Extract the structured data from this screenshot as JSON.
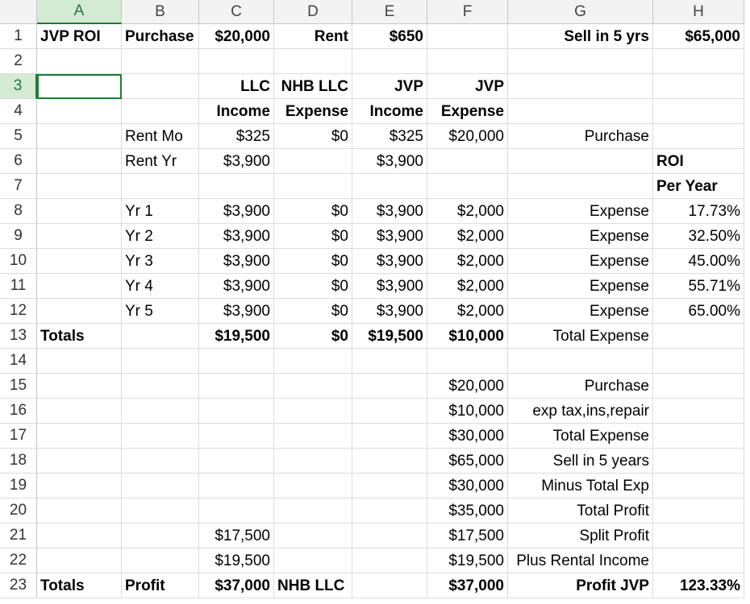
{
  "sheet": {
    "columns": [
      "A",
      "B",
      "C",
      "D",
      "E",
      "F",
      "G",
      "H"
    ],
    "selected_cell": "A3",
    "rows": [
      {
        "n": "1",
        "cells": {
          "A": "JVP ROI",
          "B": "Purchase",
          "C": "$20,000",
          "D": "Rent",
          "E": "$650",
          "G": "Sell in 5 yrs",
          "H": "$65,000"
        }
      },
      {
        "n": "2",
        "cells": {}
      },
      {
        "n": "3",
        "cells": {
          "C": "LLC",
          "D": "NHB LLC",
          "E": "JVP",
          "F": "JVP"
        }
      },
      {
        "n": "4",
        "cells": {
          "C": "Income",
          "D": "Expense",
          "E": "Income",
          "F": "Expense"
        }
      },
      {
        "n": "5",
        "cells": {
          "B": "Rent Mo",
          "C": "$325",
          "D": "$0",
          "E": "$325",
          "F": "$20,000",
          "G": "Purchase"
        }
      },
      {
        "n": "6",
        "cells": {
          "B": "Rent Yr",
          "C": "$3,900",
          "E": "$3,900",
          "H": "ROI"
        }
      },
      {
        "n": "7",
        "cells": {
          "H": "Per Year"
        }
      },
      {
        "n": "8",
        "cells": {
          "B": "Yr 1",
          "C": "$3,900",
          "D": "$0",
          "E": "$3,900",
          "F": "$2,000",
          "G": "Expense",
          "H": "17.73%"
        }
      },
      {
        "n": "9",
        "cells": {
          "B": "Yr 2",
          "C": "$3,900",
          "D": "$0",
          "E": "$3,900",
          "F": "$2,000",
          "G": "Expense",
          "H": "32.50%"
        }
      },
      {
        "n": "10",
        "cells": {
          "B": "Yr 3",
          "C": "$3,900",
          "D": "$0",
          "E": "$3,900",
          "F": "$2,000",
          "G": "Expense",
          "H": "45.00%"
        }
      },
      {
        "n": "11",
        "cells": {
          "B": "Yr 4",
          "C": "$3,900",
          "D": "$0",
          "E": "$3,900",
          "F": "$2,000",
          "G": "Expense",
          "H": "55.71%"
        }
      },
      {
        "n": "12",
        "cells": {
          "B": "Yr 5",
          "C": "$3,900",
          "D": "$0",
          "E": "$3,900",
          "F": "$2,000",
          "G": "Expense",
          "H": "65.00%"
        }
      },
      {
        "n": "13",
        "cells": {
          "A": "Totals",
          "C": "$19,500",
          "D": "$0",
          "E": "$19,500",
          "F": "$10,000",
          "G": "Total Expense"
        }
      },
      {
        "n": "14",
        "cells": {}
      },
      {
        "n": "15",
        "cells": {
          "F": "$20,000",
          "G": "Purchase"
        }
      },
      {
        "n": "16",
        "cells": {
          "F": "$10,000",
          "G": "exp tax,ins,repair"
        }
      },
      {
        "n": "17",
        "cells": {
          "F": "$30,000",
          "G": "Total Expense"
        }
      },
      {
        "n": "18",
        "cells": {
          "F": "$65,000",
          "G": "Sell in 5 years"
        }
      },
      {
        "n": "19",
        "cells": {
          "F": "$30,000",
          "G": "Minus Total Exp"
        }
      },
      {
        "n": "20",
        "cells": {
          "F": "$35,000",
          "G": "Total Profit"
        }
      },
      {
        "n": "21",
        "cells": {
          "C": "$17,500",
          "F": "$17,500",
          "G": "Split Profit"
        }
      },
      {
        "n": "22",
        "cells": {
          "C": "$19,500",
          "F": "$19,500",
          "G": "Plus Rental Income"
        }
      },
      {
        "n": "23",
        "cells": {
          "A": "Totals",
          "B": "Profit",
          "C": "$37,000",
          "D": "NHB LLC",
          "F": "$37,000",
          "G": "Profit JVP",
          "H": "123.33%"
        }
      }
    ],
    "bold_cells": [
      "A1",
      "B1",
      "C1",
      "D1",
      "E1",
      "G1",
      "H1",
      "C3",
      "D3",
      "E3",
      "F3",
      "C4",
      "D4",
      "E4",
      "F4",
      "H6",
      "H7",
      "A13",
      "C13",
      "D13",
      "E13",
      "F13",
      "A23",
      "B23",
      "C23",
      "D23",
      "F23",
      "G23",
      "H23"
    ],
    "left_aligned_cells": [
      "A1",
      "B1",
      "B5",
      "B6",
      "B8",
      "B9",
      "B10",
      "B11",
      "B12",
      "A13",
      "A23",
      "B23",
      "D23",
      "H6",
      "H7"
    ],
    "accent_color": "#1e7b34"
  }
}
